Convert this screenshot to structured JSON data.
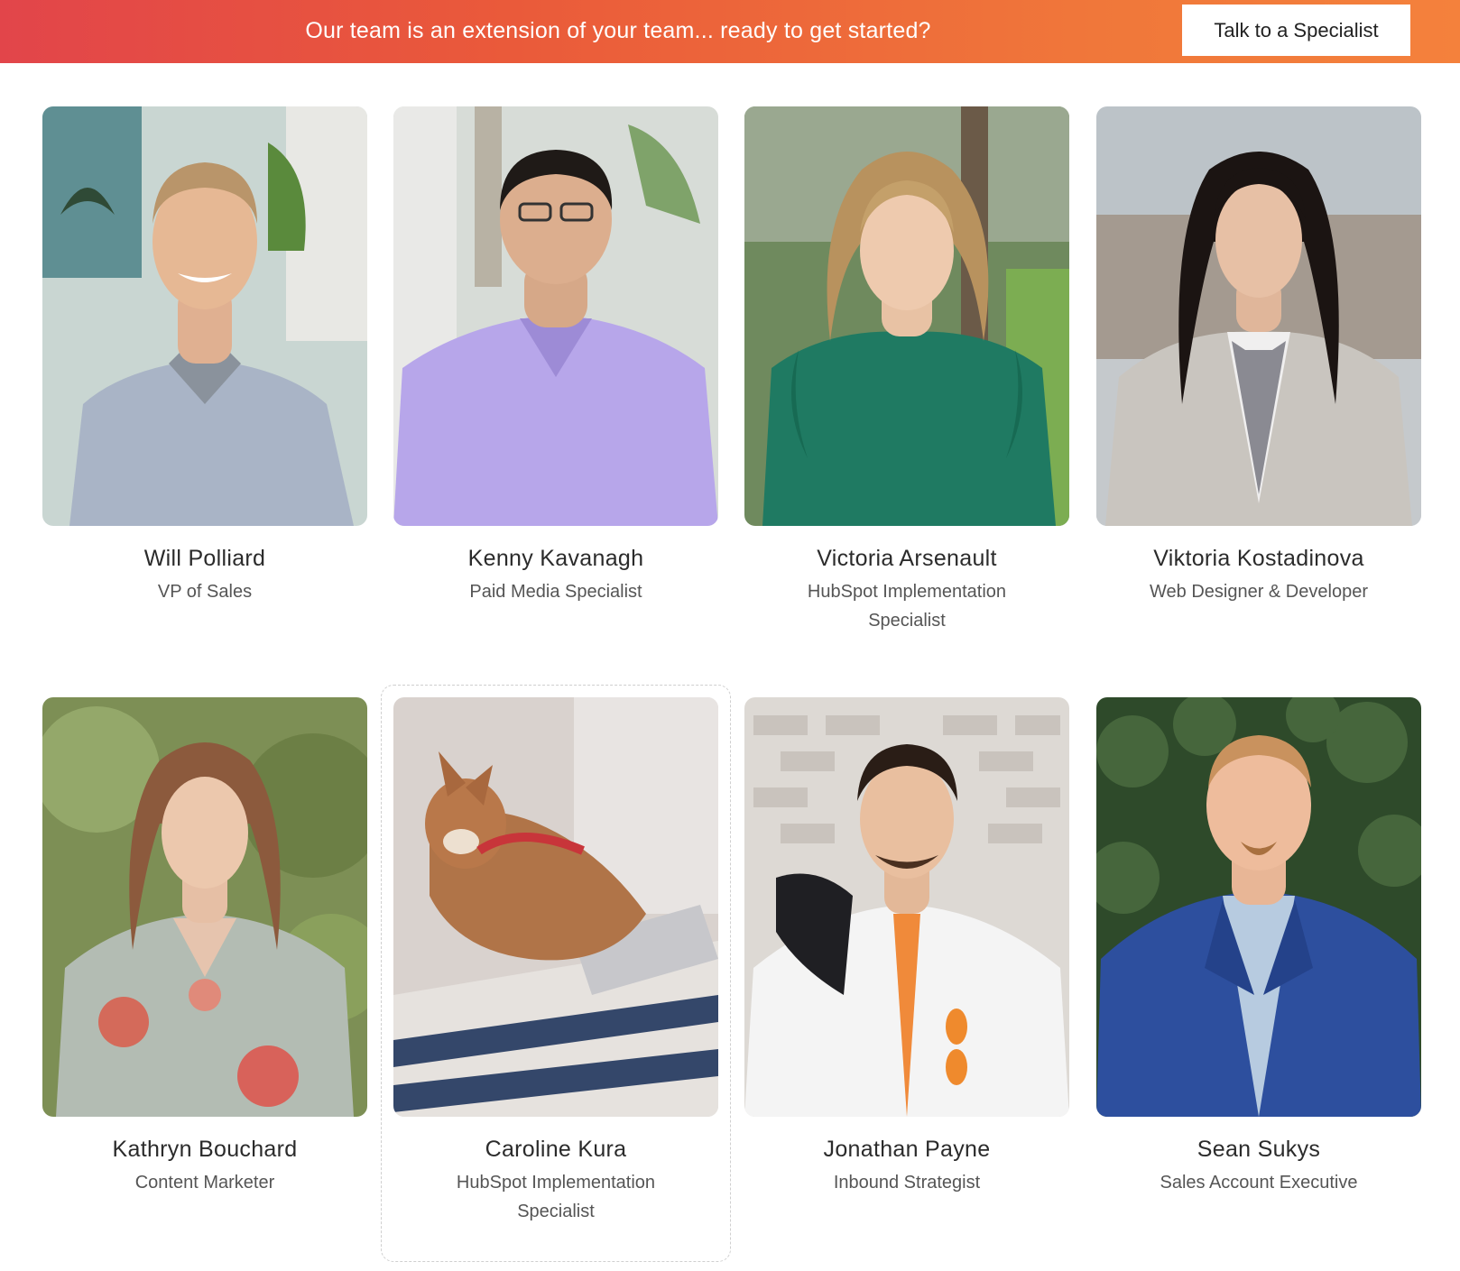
{
  "banner": {
    "text": "Our team is an extension of your team... ready to get started?",
    "cta_label": "Talk to a Specialist"
  },
  "colors": {
    "banner_start": "#e2454a",
    "banner_end": "#f4813c",
    "name_text": "#2b2b2b",
    "role_text": "#555555"
  },
  "team": [
    {
      "name": "Will Polliard",
      "role": "VP of Sales"
    },
    {
      "name": "Kenny Kavanagh",
      "role": "Paid Media Specialist"
    },
    {
      "name": "Victoria Arsenault",
      "role": "HubSpot Implementation Specialist"
    },
    {
      "name": "Viktoria Kostadinova",
      "role": "Web Designer & Developer"
    },
    {
      "name": "Kathryn Bouchard",
      "role": "Content Marketer"
    },
    {
      "name": "Caroline Kura",
      "role": "HubSpot Implementation Specialist"
    },
    {
      "name": "Jonathan Payne",
      "role": "Inbound Strategist"
    },
    {
      "name": "Sean Sukys",
      "role": "Sales Account Executive"
    }
  ]
}
